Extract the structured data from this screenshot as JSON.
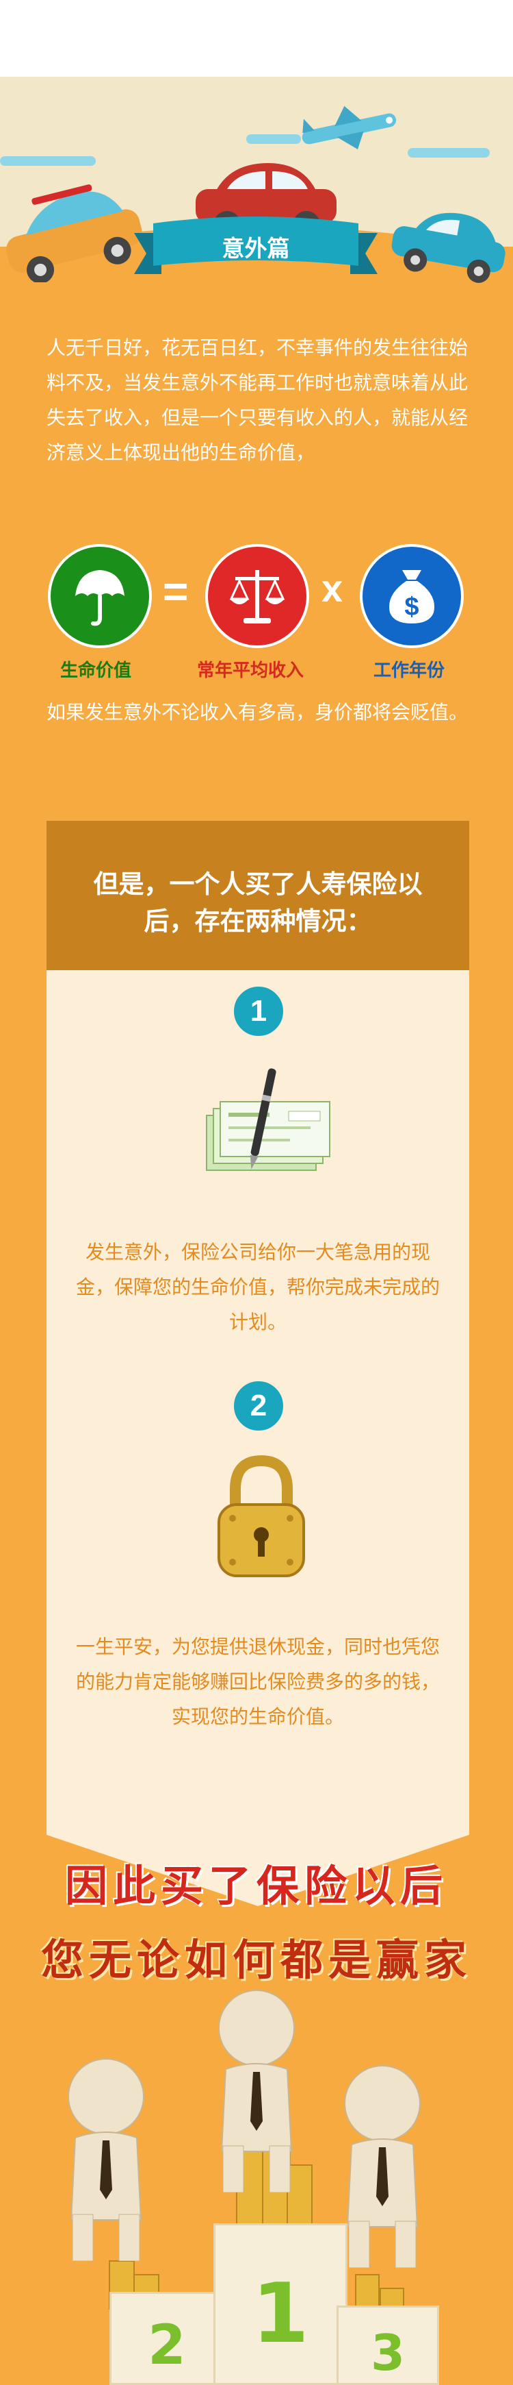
{
  "section_title": "意外篇",
  "intro_text": "人无千日好，花无百日红，不幸事件的发生往往始料不及，当发生意外不能再工作时也就意味着从此失去了收入，但是一个只要有收入的人，就能从经济意义上体现出他的生命价值，",
  "formula": {
    "equals": "=",
    "times": "x",
    "items": [
      {
        "label": "生命价值",
        "icon": "umbrella-icon",
        "color": "#1a8f1a",
        "label_color": "#1a7d12"
      },
      {
        "label": "常年平均收入",
        "icon": "scale-icon",
        "color": "#e02828",
        "label_color": "#d32c1f"
      },
      {
        "label": "工作年份",
        "icon": "money-bag-icon",
        "color": "#1268c8",
        "label_color": "#1a5fb4"
      }
    ]
  },
  "after_text": "如果发生意外不论收入有多高，身价都将会贬值。",
  "panel": {
    "heading": "但是，一个人买了人寿保险以后，存在两种情况：",
    "case1": {
      "number": "1",
      "icon": "check-pen-icon",
      "text": "发生意外，保险公司给你一大笔急用的现金，保障您的生命价值，帮你完成未完成的计划。"
    },
    "case2": {
      "number": "2",
      "icon": "padlock-icon",
      "text": "一生平安，为您提供退休现金，同时也凭您的能力肯定能够赚回比保险费多的多的钱，实现您的生命价值。"
    }
  },
  "slogan": {
    "line1": "因此买了保险以后",
    "line2": "您无论如何都是赢家"
  },
  "podium": {
    "left": "2",
    "center": "1",
    "right": "3"
  },
  "colors": {
    "background": "#f7aa3f",
    "teal": "#1aa6bf",
    "panel": "#fdeed8",
    "panel_header": "#c7811f"
  }
}
